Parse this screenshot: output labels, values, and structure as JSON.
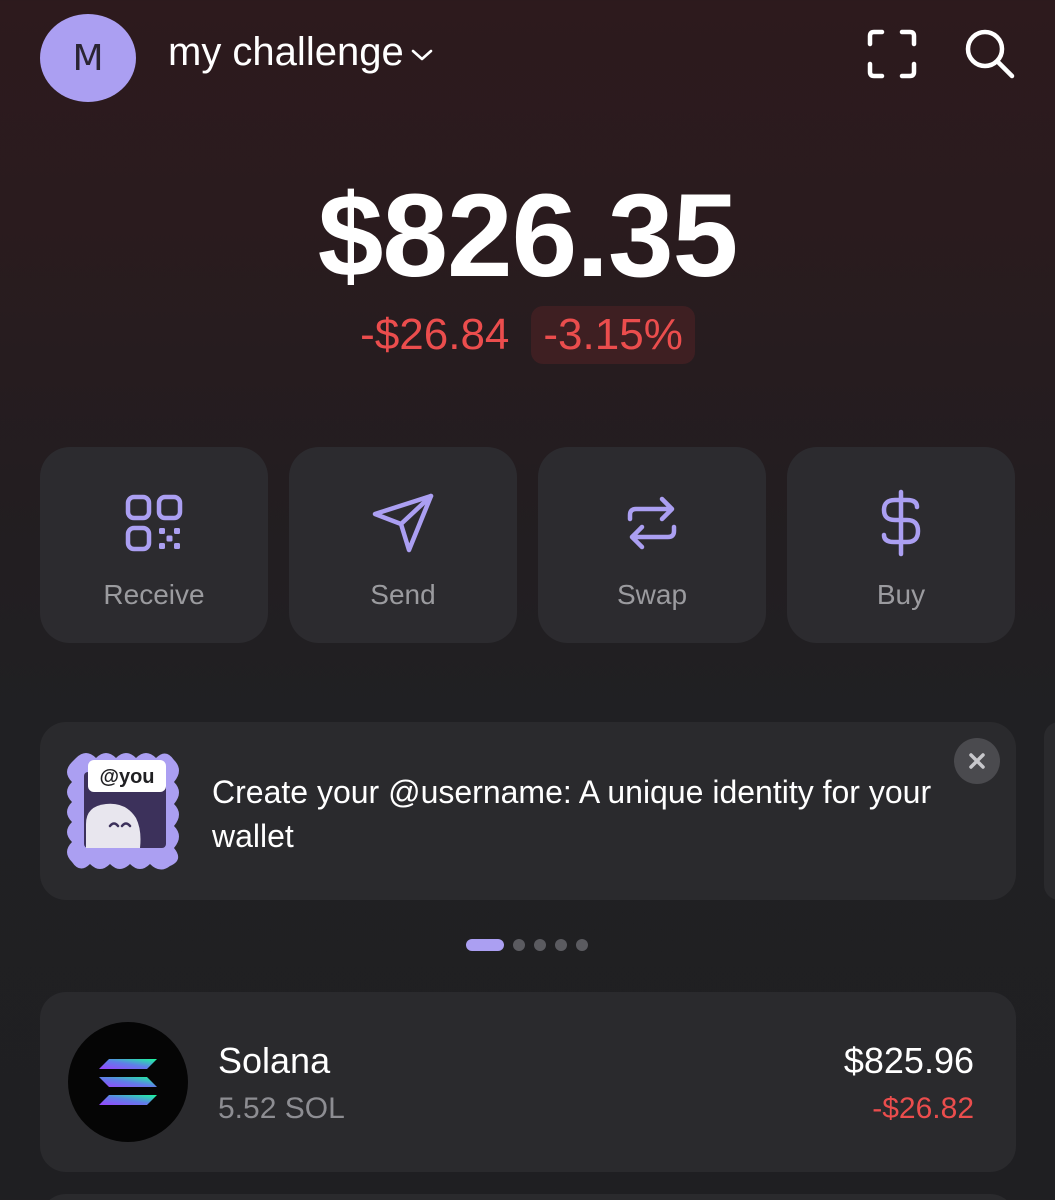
{
  "header": {
    "avatar_initial": "M",
    "account_name": "my challenge",
    "scan_icon": "scan-frame-icon",
    "search_icon": "search-icon"
  },
  "balance": {
    "total": "$826.35",
    "change_amount": "-$26.84",
    "change_percent": "-3.15%"
  },
  "actions": [
    {
      "label": "Receive",
      "icon": "qr-code-icon"
    },
    {
      "label": "Send",
      "icon": "paper-plane-icon"
    },
    {
      "label": "Swap",
      "icon": "swap-arrows-icon"
    },
    {
      "label": "Buy",
      "icon": "dollar-icon"
    }
  ],
  "banner": {
    "badge_text": "@you",
    "text": "Create your @username: A unique identity for your wallet",
    "close_icon": "close-icon"
  },
  "carousel": {
    "page_count": 5,
    "active_index": 0
  },
  "tokens": [
    {
      "name": "Solana",
      "amount": "5.52 SOL",
      "value": "$825.96",
      "change": "-$26.82",
      "icon": "solana-logo-icon"
    }
  ],
  "colors": {
    "accent": "#ab9ff2",
    "negative": "#eb4d4d",
    "card": "#2c2b2f"
  }
}
